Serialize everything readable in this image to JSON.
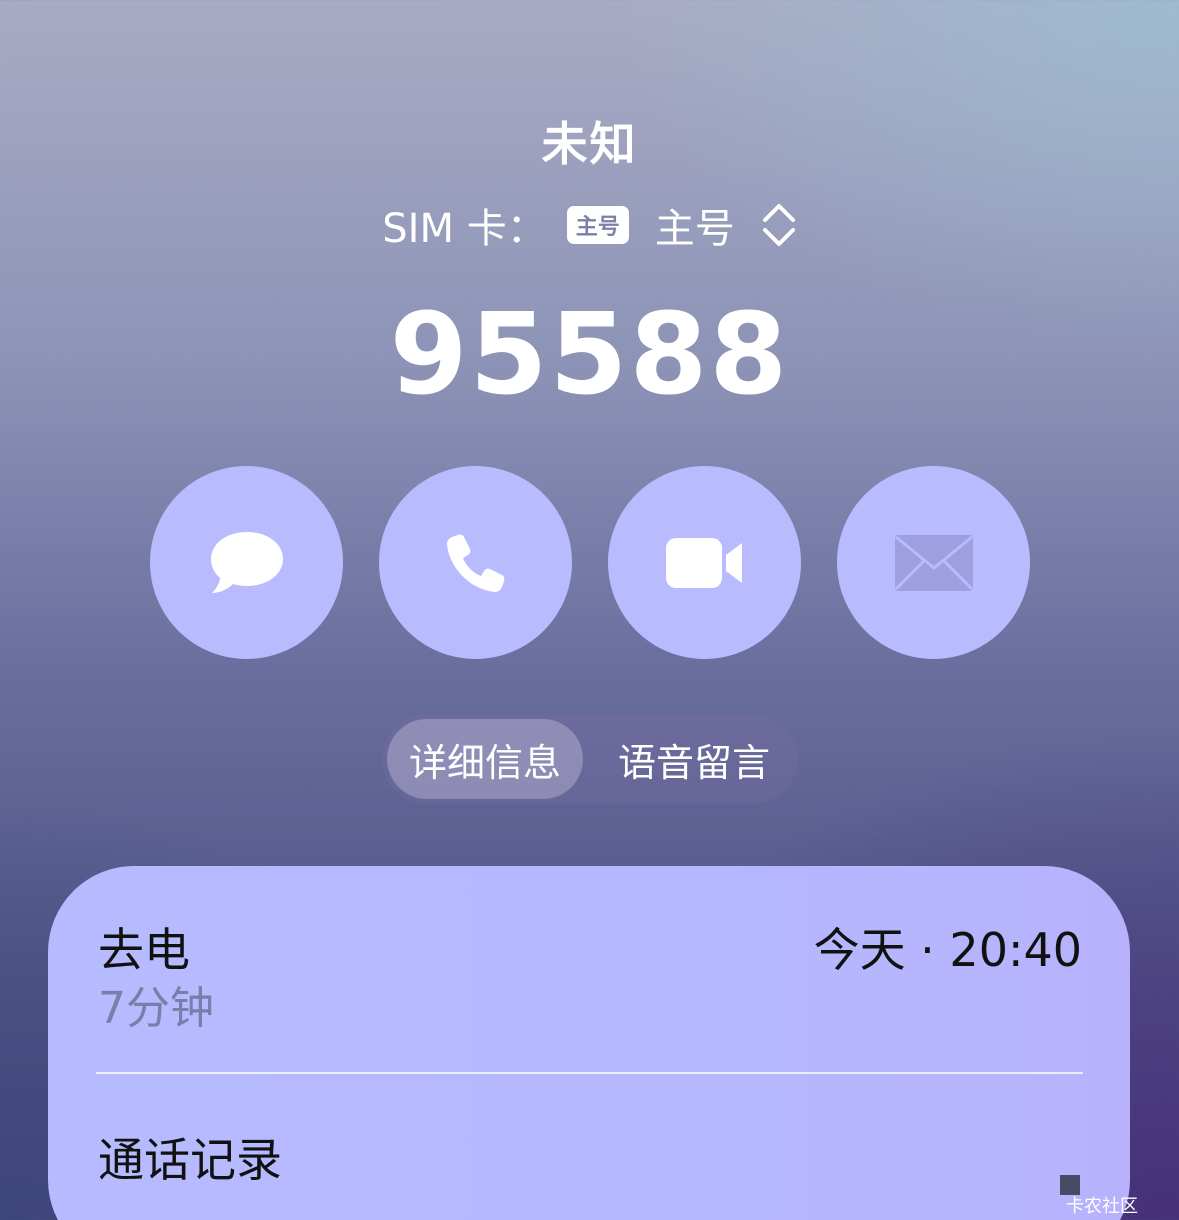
{
  "header": {
    "caller_label": "未知",
    "sim_prefix": "SIM 卡：",
    "sim_badge": "主号",
    "sim_name": "主号",
    "phone_number": "95588"
  },
  "actions": [
    {
      "icon": "message-bubble-icon"
    },
    {
      "icon": "phone-icon"
    },
    {
      "icon": "video-camera-icon"
    },
    {
      "icon": "mail-icon"
    }
  ],
  "tabs": {
    "details": "详细信息",
    "voicemail": "语音留言",
    "active": "details"
  },
  "call_entry": {
    "type": "去电",
    "duration": "7分钟",
    "time": "今天 · 20:40"
  },
  "card": {
    "call_history_label": "通话记录"
  },
  "watermark": {
    "text": "卡农社区"
  },
  "colors": {
    "button_fill": "#b8bcff",
    "card_fill": "#b6baff",
    "secondary_text": "#7a7ea8"
  }
}
